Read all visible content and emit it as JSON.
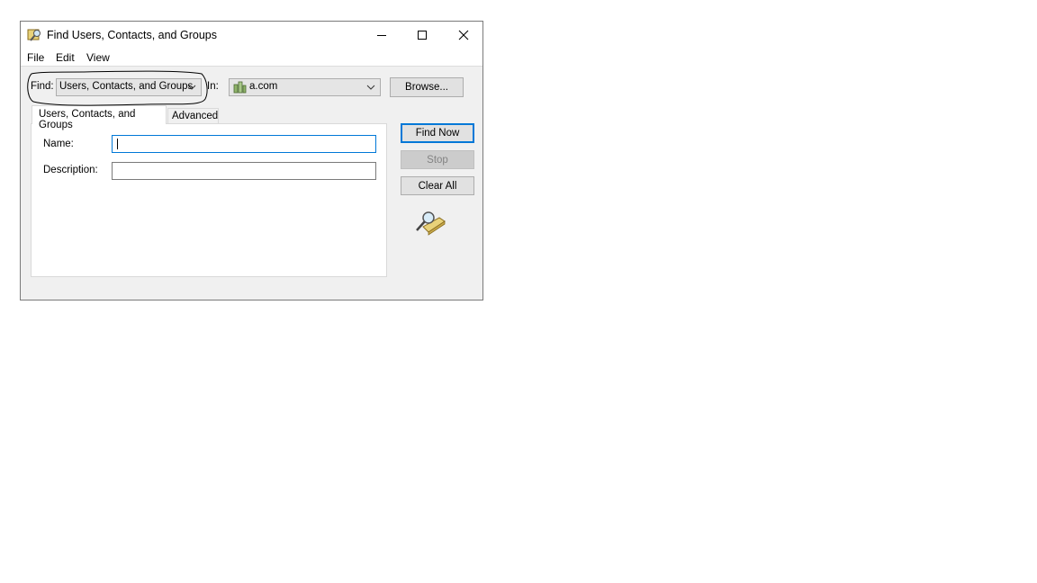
{
  "window": {
    "title": "Find Users, Contacts, and Groups",
    "icon": "find-dialog-icon",
    "controls": {
      "minimize": "minimize-icon",
      "maximize": "maximize-icon",
      "close": "close-icon"
    }
  },
  "menubar": {
    "items": [
      "File",
      "Edit",
      "View"
    ]
  },
  "find": {
    "label": "Find:",
    "selected": "Users, Contacts, and Groups"
  },
  "in": {
    "label": "In:",
    "selected": "a.com",
    "icon": "domain-icon"
  },
  "buttons": {
    "browse": "Browse...",
    "find_now": "Find Now",
    "stop": "Stop",
    "clear_all": "Clear All"
  },
  "tabs": [
    "Users, Contacts, and Groups",
    "Advanced"
  ],
  "fields": {
    "name_label": "Name:",
    "name_value": "",
    "description_label": "Description:",
    "description_value": ""
  },
  "graphic": "search-magnifier-icon",
  "colors": {
    "accent": "#0078d7",
    "window_bg": "#f0f0f0"
  }
}
